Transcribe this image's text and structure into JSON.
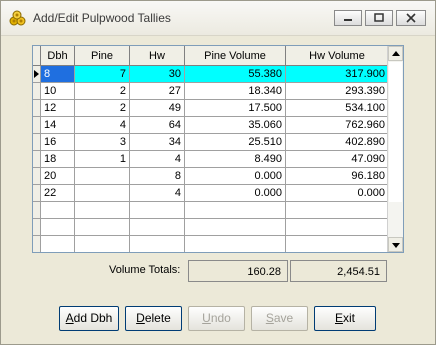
{
  "window": {
    "title": "Add/Edit Pulpwood Tallies",
    "icon": "wood-logs-icon"
  },
  "grid": {
    "columns": [
      "Dbh",
      "Pine",
      "Hw",
      "Pine Volume",
      "Hw Volume"
    ],
    "rows": [
      {
        "dbh": "8",
        "pine": "7",
        "hw": "30",
        "pine_volume": "55.380",
        "hw_volume": "317.900"
      },
      {
        "dbh": "10",
        "pine": "2",
        "hw": "27",
        "pine_volume": "18.340",
        "hw_volume": "293.390"
      },
      {
        "dbh": "12",
        "pine": "2",
        "hw": "49",
        "pine_volume": "17.500",
        "hw_volume": "534.100"
      },
      {
        "dbh": "14",
        "pine": "4",
        "hw": "64",
        "pine_volume": "35.060",
        "hw_volume": "762.960"
      },
      {
        "dbh": "16",
        "pine": "3",
        "hw": "34",
        "pine_volume": "25.510",
        "hw_volume": "402.890"
      },
      {
        "dbh": "18",
        "pine": "1",
        "hw": "4",
        "pine_volume": "8.490",
        "hw_volume": "47.090"
      },
      {
        "dbh": "20",
        "pine": "",
        "hw": "8",
        "pine_volume": "0.000",
        "hw_volume": "96.180"
      },
      {
        "dbh": "22",
        "pine": "",
        "hw": "4",
        "pine_volume": "0.000",
        "hw_volume": "0.000"
      },
      {
        "dbh": "",
        "pine": "",
        "hw": "",
        "pine_volume": "",
        "hw_volume": ""
      },
      {
        "dbh": "",
        "pine": "",
        "hw": "",
        "pine_volume": "",
        "hw_volume": ""
      },
      {
        "dbh": "",
        "pine": "",
        "hw": "",
        "pine_volume": "",
        "hw_volume": ""
      }
    ],
    "selected_row_color": "#00ffff"
  },
  "totals": {
    "label": "Volume Totals:",
    "pine": "160.28",
    "hw": "2,454.51"
  },
  "buttons": {
    "add_dbh": {
      "pre": "",
      "key": "A",
      "post": "dd Dbh"
    },
    "delete": {
      "pre": "",
      "key": "D",
      "post": "elete"
    },
    "undo": {
      "pre": "",
      "key": "U",
      "post": "ndo"
    },
    "save": {
      "pre": "",
      "key": "S",
      "post": "ave"
    },
    "exit": {
      "pre": "",
      "key": "E",
      "post": "xit"
    }
  }
}
